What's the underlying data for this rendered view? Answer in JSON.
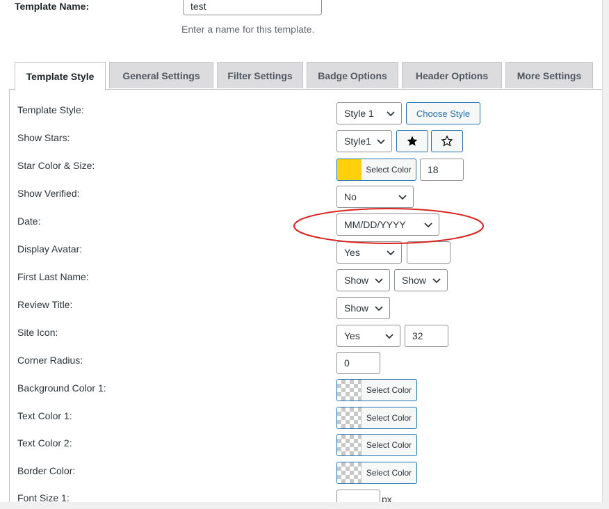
{
  "template_name": {
    "label": "Template Name:",
    "value": "test",
    "help": "Enter a name for this template."
  },
  "tabs": [
    {
      "label": "Template Style"
    },
    {
      "label": "General Settings"
    },
    {
      "label": "Filter Settings"
    },
    {
      "label": "Badge Options"
    },
    {
      "label": "Header Options"
    },
    {
      "label": "More Settings"
    }
  ],
  "fields": {
    "template_style": {
      "label": "Template Style:",
      "value": "Style 1",
      "button": "Choose Style"
    },
    "show_stars": {
      "label": "Show Stars:",
      "value": "Style1",
      "filled_icon": "filled-star-icon",
      "empty_icon": "outline-star-icon"
    },
    "star_color_size": {
      "label": "Star Color & Size:",
      "color": "#ffd10a",
      "button": "Select Color",
      "size": "18"
    },
    "show_verified": {
      "label": "Show Verified:",
      "value": "No"
    },
    "date": {
      "label": "Date:",
      "value": "MM/DD/YYYY"
    },
    "display_avatar": {
      "label": "Display Avatar:",
      "value": "Yes",
      "size": ""
    },
    "first_last_name": {
      "label": "First Last Name:",
      "first": "Show",
      "last": "Show"
    },
    "review_title": {
      "label": "Review Title:",
      "value": "Show"
    },
    "site_icon": {
      "label": "Site Icon:",
      "value": "Yes",
      "size": "32"
    },
    "corner_radius": {
      "label": "Corner Radius:",
      "value": "0"
    },
    "background_color_1": {
      "label": "Background Color 1:",
      "button": "Select Color"
    },
    "text_color_1": {
      "label": "Text Color 1:",
      "button": "Select Color"
    },
    "text_color_2": {
      "label": "Text Color 2:",
      "button": "Select Color"
    },
    "border_color": {
      "label": "Border Color:",
      "button": "Select Color"
    },
    "font_size_1": {
      "label": "Font Size 1:",
      "value": "",
      "unit": "px"
    }
  },
  "annotation_color": "#d9231e"
}
